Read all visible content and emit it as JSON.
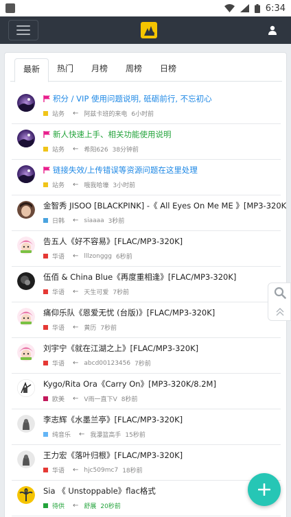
{
  "status_bar": {
    "time": "6:34"
  },
  "tabs": [
    "最新",
    "热门",
    "月榜",
    "周榜",
    "日榜"
  ],
  "colors": {
    "nav": "#2f3640",
    "accent": "#26c6b5",
    "link": "#1e88e5"
  },
  "threads": [
    {
      "title": "积分 / VIP 使用问题说明, 砥砺前行, 不忘初心",
      "style": "sticky",
      "flag": true,
      "category": "站务",
      "cat_color": "#f0c419",
      "arrow": "←",
      "author": "阿兹卡班的来电",
      "time": "6小时前",
      "avatar": "galaxy"
    },
    {
      "title": "新人快速上手、相关功能使用说明",
      "style": "sticky-green",
      "flag": true,
      "category": "站务",
      "cat_color": "#f0c419",
      "arrow": "←",
      "author": "希阳626",
      "time": "38分钟前",
      "avatar": "galaxy"
    },
    {
      "title": "链接失效/上传错误等资源问题在这里处理",
      "style": "sticky",
      "flag": true,
      "category": "站务",
      "cat_color": "#f0c419",
      "arrow": "←",
      "author": "哦我哈壕",
      "time": "3小时前",
      "avatar": "galaxy"
    },
    {
      "title": "金智秀 JISOO [BLACKPINK] -《 All Eyes On Me ME 》[MP3-320K]",
      "style": "normal",
      "flag": false,
      "category": "日韩",
      "cat_color": "#4aa3df",
      "arrow": "←",
      "author": "siaaaa",
      "time": "3秒前",
      "avatar": "face"
    },
    {
      "title": "告五人《好不容易》[FLAC/MP3-320K]",
      "style": "normal",
      "flag": false,
      "category": "华语",
      "cat_color": "#e53935",
      "arrow": "←",
      "author": "lllzonggg",
      "time": "6秒前",
      "avatar": "pink"
    },
    {
      "title": "伍佰 & China Blue《再度重相逢》[FLAC/MP3-320K]",
      "style": "normal",
      "flag": false,
      "category": "华语",
      "cat_color": "#e53935",
      "arrow": "←",
      "author": "天生可爱",
      "time": "7秒前",
      "avatar": "dark"
    },
    {
      "title": "痛仰乐队《恩爱无忧 (台版)》[FLAC/MP3-320K]",
      "style": "normal",
      "flag": false,
      "category": "华语",
      "cat_color": "#e53935",
      "arrow": "←",
      "author": "黄历",
      "time": "7秒前",
      "avatar": "pink"
    },
    {
      "title": "刘宇宁《就在江湖之上》[FLAC/MP3-320K]",
      "style": "normal",
      "flag": false,
      "category": "华语",
      "cat_color": "#e53935",
      "arrow": "←",
      "author": "abcd00123456",
      "time": "7秒前",
      "avatar": "pink"
    },
    {
      "title": "Kygo/Rita Ora《Carry On》[MP3-320K/8.2M]",
      "style": "normal",
      "flag": false,
      "category": "欧美",
      "cat_color": "#c2185b",
      "arrow": "←",
      "author": "V雨一直下V",
      "time": "8秒前",
      "avatar": "sketch"
    },
    {
      "title": "李志辉《水墨兰亭》[FLAC/MP3-320K]",
      "style": "normal",
      "flag": false,
      "category": "纯音乐",
      "cat_color": "#64b5f6",
      "arrow": "←",
      "author": "我瀑篮高手",
      "time": "15秒前",
      "avatar": "ghost"
    },
    {
      "title": "王力宏《落叶归根》[FLAC/MP3-320K]",
      "style": "normal",
      "flag": false,
      "category": "华语",
      "cat_color": "#e53935",
      "arrow": "←",
      "author": "hjc509mc7",
      "time": "18秒前",
      "avatar": "ghost"
    },
    {
      "title": "Sia 《 Unstoppable》flac格式",
      "style": "normal",
      "flag": false,
      "category": "待供",
      "cat_color": "#22a33a",
      "arrow": "←",
      "author": "舒展",
      "time": "20秒前",
      "avatar": "palm",
      "meta_color": "#22a33a"
    }
  ]
}
